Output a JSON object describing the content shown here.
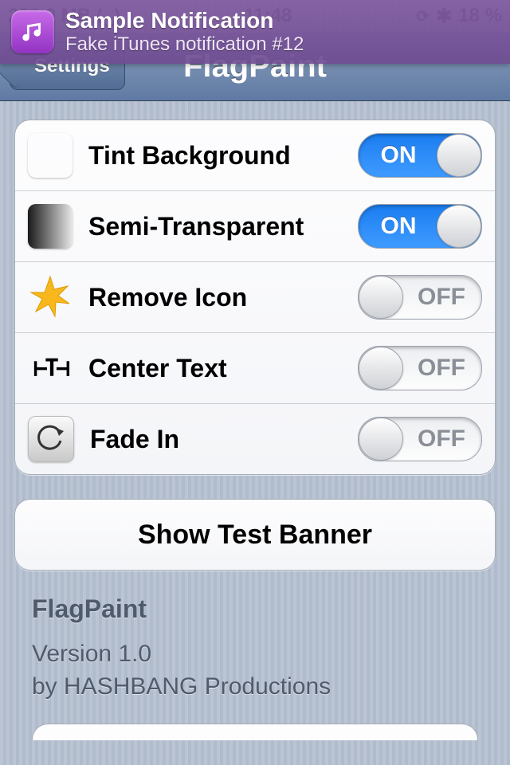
{
  "statusbar": {
    "left_text": "231.9 MB",
    "time": "11:48",
    "battery": "18 %"
  },
  "navbar": {
    "back_label": "Settings",
    "title": "FlagPaint"
  },
  "banner": {
    "title": "Sample Notification",
    "subtitle": "Fake iTunes notification #12"
  },
  "toggles": {
    "on_label": "ON",
    "off_label": "OFF",
    "items": [
      {
        "label": "Tint Background",
        "value": true
      },
      {
        "label": "Semi-Transparent",
        "value": true
      },
      {
        "label": "Remove Icon",
        "value": false
      },
      {
        "label": "Center Text",
        "value": false
      },
      {
        "label": "Fade In",
        "value": false
      }
    ]
  },
  "action_button": {
    "label": "Show Test Banner"
  },
  "footer": {
    "name": "FlagPaint",
    "version_line": "Version 1.0",
    "author_line": "by HASHBANG Productions"
  }
}
